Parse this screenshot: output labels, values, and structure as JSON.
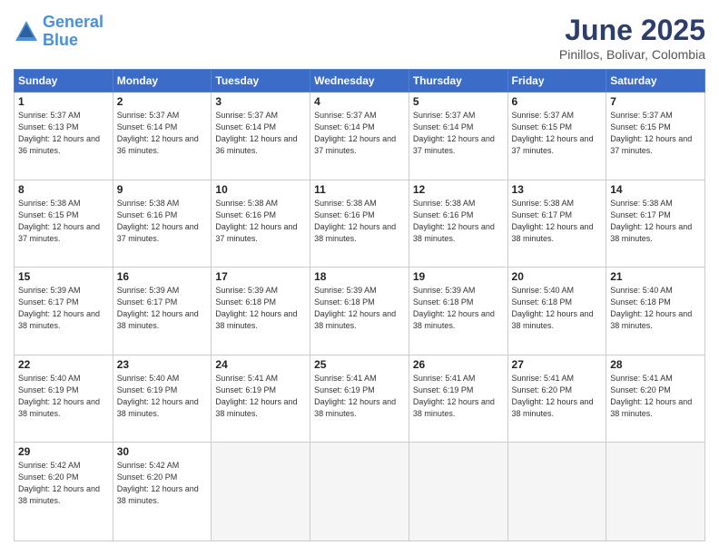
{
  "logo": {
    "line1": "General",
    "line2": "Blue"
  },
  "title": "June 2025",
  "location": "Pinillos, Bolivar, Colombia",
  "days_header": [
    "Sunday",
    "Monday",
    "Tuesday",
    "Wednesday",
    "Thursday",
    "Friday",
    "Saturday"
  ],
  "weeks": [
    [
      {
        "day": "1",
        "sunrise": "5:37 AM",
        "sunset": "6:13 PM",
        "daylight": "12 hours and 36 minutes."
      },
      {
        "day": "2",
        "sunrise": "5:37 AM",
        "sunset": "6:14 PM",
        "daylight": "12 hours and 36 minutes."
      },
      {
        "day": "3",
        "sunrise": "5:37 AM",
        "sunset": "6:14 PM",
        "daylight": "12 hours and 36 minutes."
      },
      {
        "day": "4",
        "sunrise": "5:37 AM",
        "sunset": "6:14 PM",
        "daylight": "12 hours and 37 minutes."
      },
      {
        "day": "5",
        "sunrise": "5:37 AM",
        "sunset": "6:14 PM",
        "daylight": "12 hours and 37 minutes."
      },
      {
        "day": "6",
        "sunrise": "5:37 AM",
        "sunset": "6:15 PM",
        "daylight": "12 hours and 37 minutes."
      },
      {
        "day": "7",
        "sunrise": "5:37 AM",
        "sunset": "6:15 PM",
        "daylight": "12 hours and 37 minutes."
      }
    ],
    [
      {
        "day": "8",
        "sunrise": "5:38 AM",
        "sunset": "6:15 PM",
        "daylight": "12 hours and 37 minutes."
      },
      {
        "day": "9",
        "sunrise": "5:38 AM",
        "sunset": "6:16 PM",
        "daylight": "12 hours and 37 minutes."
      },
      {
        "day": "10",
        "sunrise": "5:38 AM",
        "sunset": "6:16 PM",
        "daylight": "12 hours and 37 minutes."
      },
      {
        "day": "11",
        "sunrise": "5:38 AM",
        "sunset": "6:16 PM",
        "daylight": "12 hours and 38 minutes."
      },
      {
        "day": "12",
        "sunrise": "5:38 AM",
        "sunset": "6:16 PM",
        "daylight": "12 hours and 38 minutes."
      },
      {
        "day": "13",
        "sunrise": "5:38 AM",
        "sunset": "6:17 PM",
        "daylight": "12 hours and 38 minutes."
      },
      {
        "day": "14",
        "sunrise": "5:38 AM",
        "sunset": "6:17 PM",
        "daylight": "12 hours and 38 minutes."
      }
    ],
    [
      {
        "day": "15",
        "sunrise": "5:39 AM",
        "sunset": "6:17 PM",
        "daylight": "12 hours and 38 minutes."
      },
      {
        "day": "16",
        "sunrise": "5:39 AM",
        "sunset": "6:17 PM",
        "daylight": "12 hours and 38 minutes."
      },
      {
        "day": "17",
        "sunrise": "5:39 AM",
        "sunset": "6:18 PM",
        "daylight": "12 hours and 38 minutes."
      },
      {
        "day": "18",
        "sunrise": "5:39 AM",
        "sunset": "6:18 PM",
        "daylight": "12 hours and 38 minutes."
      },
      {
        "day": "19",
        "sunrise": "5:39 AM",
        "sunset": "6:18 PM",
        "daylight": "12 hours and 38 minutes."
      },
      {
        "day": "20",
        "sunrise": "5:40 AM",
        "sunset": "6:18 PM",
        "daylight": "12 hours and 38 minutes."
      },
      {
        "day": "21",
        "sunrise": "5:40 AM",
        "sunset": "6:18 PM",
        "daylight": "12 hours and 38 minutes."
      }
    ],
    [
      {
        "day": "22",
        "sunrise": "5:40 AM",
        "sunset": "6:19 PM",
        "daylight": "12 hours and 38 minutes."
      },
      {
        "day": "23",
        "sunrise": "5:40 AM",
        "sunset": "6:19 PM",
        "daylight": "12 hours and 38 minutes."
      },
      {
        "day": "24",
        "sunrise": "5:41 AM",
        "sunset": "6:19 PM",
        "daylight": "12 hours and 38 minutes."
      },
      {
        "day": "25",
        "sunrise": "5:41 AM",
        "sunset": "6:19 PM",
        "daylight": "12 hours and 38 minutes."
      },
      {
        "day": "26",
        "sunrise": "5:41 AM",
        "sunset": "6:19 PM",
        "daylight": "12 hours and 38 minutes."
      },
      {
        "day": "27",
        "sunrise": "5:41 AM",
        "sunset": "6:20 PM",
        "daylight": "12 hours and 38 minutes."
      },
      {
        "day": "28",
        "sunrise": "5:41 AM",
        "sunset": "6:20 PM",
        "daylight": "12 hours and 38 minutes."
      }
    ],
    [
      {
        "day": "29",
        "sunrise": "5:42 AM",
        "sunset": "6:20 PM",
        "daylight": "12 hours and 38 minutes."
      },
      {
        "day": "30",
        "sunrise": "5:42 AM",
        "sunset": "6:20 PM",
        "daylight": "12 hours and 38 minutes."
      },
      null,
      null,
      null,
      null,
      null
    ]
  ]
}
